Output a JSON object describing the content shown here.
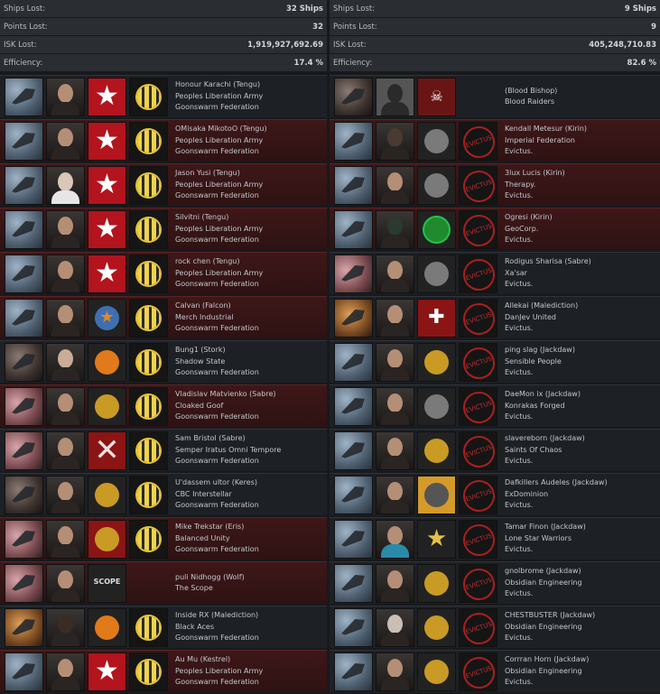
{
  "left": {
    "stats": [
      {
        "label": "Ships Lost:",
        "value": "32 Ships"
      },
      {
        "label": "Points Lost:",
        "value": "32"
      },
      {
        "label": "ISK Lost:",
        "value": "1,919,927,692.69"
      },
      {
        "label": "Efficiency:",
        "value": "17.4 %"
      }
    ],
    "rows": [
      {
        "pilot": "Honour Karachi (Tengu)",
        "corp": "Peoples Liberation Army",
        "alliance": "Goonswarm Federation"
      },
      {
        "pilot": "OMisaka MikotoO (Tengu)",
        "corp": "Peoples Liberation Army",
        "alliance": "Goonswarm Federation"
      },
      {
        "pilot": "Jason Yusi (Tengu)",
        "corp": "Peoples Liberation Army",
        "alliance": "Goonswarm Federation"
      },
      {
        "pilot": "Silvitni (Tengu)",
        "corp": "Peoples Liberation Army",
        "alliance": "Goonswarm Federation"
      },
      {
        "pilot": "rock chen (Tengu)",
        "corp": "Peoples Liberation Army",
        "alliance": "Goonswarm Federation"
      },
      {
        "pilot": "Calvan (Falcon)",
        "corp": "Merch Industrial",
        "alliance": "Goonswarm Federation"
      },
      {
        "pilot": "Bung1 (Stork)",
        "corp": "Shadow State",
        "alliance": "Goonswarm Federation"
      },
      {
        "pilot": "Vladislav Matvienko (Sabre)",
        "corp": "Cloaked Goof",
        "alliance": "Goonswarm Federation"
      },
      {
        "pilot": "Sam Bristol (Sabre)",
        "corp": "Semper Iratus Omni Tempore",
        "alliance": "Goonswarm Federation"
      },
      {
        "pilot": "U'dassem ultor (Keres)",
        "corp": "CBC Interstellar",
        "alliance": "Goonswarm Federation"
      },
      {
        "pilot": "Mike Trekstar (Eris)",
        "corp": "Balanced Unity",
        "alliance": "Goonswarm Federation"
      },
      {
        "pilot": "puli Nidhogg (Wolf)",
        "corp": "The Scope",
        "alliance": ""
      },
      {
        "pilot": "Inside RX (Malediction)",
        "corp": "Black Aces",
        "alliance": "Goonswarm Federation"
      },
      {
        "pilot": "Au Mu (Kestrel)",
        "corp": "Peoples Liberation Army",
        "alliance": "Goonswarm Federation"
      }
    ]
  },
  "right": {
    "stats": [
      {
        "label": "Ships Lost:",
        "value": "9 Ships"
      },
      {
        "label": "Points Lost:",
        "value": "9"
      },
      {
        "label": "ISK Lost:",
        "value": "405,248,710.83"
      },
      {
        "label": "Efficiency:",
        "value": "82.6 %"
      }
    ],
    "rows": [
      {
        "pilot": "(Blood Bishop)",
        "corp": "Blood Raiders",
        "alliance": ""
      },
      {
        "pilot": "Kendall Metesur (Kirin)",
        "corp": "Imperial Federation",
        "alliance": "Evictus."
      },
      {
        "pilot": "3lux Lucis (Kirin)",
        "corp": "Therapy.",
        "alliance": "Evictus."
      },
      {
        "pilot": "Ogresi (Kirin)",
        "corp": "GeoCorp.",
        "alliance": "Evictus."
      },
      {
        "pilot": "Rodigus Sharisa (Sabre)",
        "corp": "Xa'sar",
        "alliance": "Evictus."
      },
      {
        "pilot": "Allekai (Malediction)",
        "corp": "DanJev United",
        "alliance": "Evictus."
      },
      {
        "pilot": "ping slag (Jackdaw)",
        "corp": "Sensible People",
        "alliance": "Evictus."
      },
      {
        "pilot": "DaeMon ix (Jackdaw)",
        "corp": "Konrakas Forged",
        "alliance": "Evictus."
      },
      {
        "pilot": "slavereborn (Jackdaw)",
        "corp": "Saints Of Chaos",
        "alliance": "Evictus."
      },
      {
        "pilot": "Dafkillers Audeles (Jackdaw)",
        "corp": "ExDominion",
        "alliance": "Evictus."
      },
      {
        "pilot": "Tamar Finon (Jackdaw)",
        "corp": "Lone Star Warriors",
        "alliance": "Evictus."
      },
      {
        "pilot": "gnolbrome (Jackdaw)",
        "corp": "Obsidian Engineering",
        "alliance": "Evictus."
      },
      {
        "pilot": "CHESTBUSTER (Jackdaw)",
        "corp": "Obsidian Engineering",
        "alliance": "Evictus."
      },
      {
        "pilot": "Corrran Horn (Jackdaw)",
        "corp": "Obsidian Engineering",
        "alliance": "Evictus."
      }
    ]
  },
  "corp_tiles": {
    "scope_text": "SCOPE",
    "evictus_text": "EVICTUS"
  }
}
